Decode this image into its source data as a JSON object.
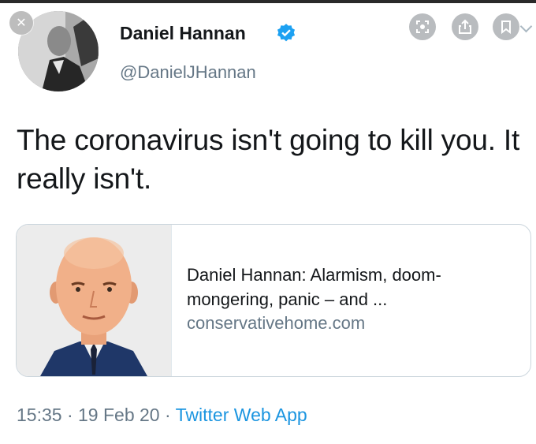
{
  "tweet": {
    "author_name": "Daniel Hannan",
    "author_handle": "@DanielJHannan",
    "verified": true,
    "text": "The coronavirus isn't going to kill you. It really isn't.",
    "time": "15:35",
    "date": "19 Feb 20",
    "separator": "·",
    "source": "Twitter Web App"
  },
  "link_card": {
    "title": "Daniel Hannan: Alarmism, doom-mongering, panic – and ...",
    "domain": "conservativehome.com"
  },
  "overlay": {
    "close_icon": "close-icon",
    "lens_icon": "lens-icon",
    "share_icon": "share-icon",
    "bookmark_icon": "bookmark-icon"
  },
  "colors": {
    "text": "#14171a",
    "secondary": "#657786",
    "link": "#1b95e0",
    "verified_badge": "#1da1f2"
  }
}
